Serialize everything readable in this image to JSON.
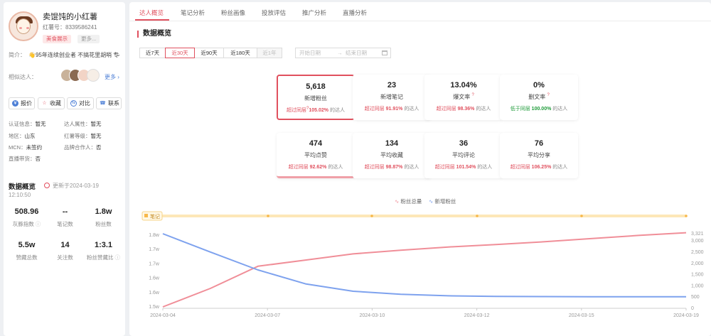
{
  "profile": {
    "nickname": "卖馄饨的小红薯",
    "red_id": "红薯号：8339586241",
    "tag_food": "美食展示",
    "tag_more": "更多...",
    "intro_label": "简介：",
    "intro_text": "👋95年连续创业者 不搞花里胡哨 专",
    "similar_label": "相似达人：",
    "similar_more": "更多",
    "buttons": {
      "quote": "报价",
      "favorite": "收藏",
      "compare": "对比",
      "contact": "联系"
    },
    "info": {
      "cert_label": "认证信息：",
      "cert_value": "暂无",
      "attr_label": "达人属性：",
      "attr_value": "暂无",
      "region_label": "地区：",
      "region_value": "山东",
      "level_label": "红薯等级：",
      "level_value": "暂无",
      "mcn_label": "MCN：",
      "mcn_value": "未签约",
      "brand_label": "品牌合作人：",
      "brand_value": "否",
      "live_label": "直播带货：",
      "live_value": "否"
    },
    "overview": {
      "title": "数据概览",
      "update_line1": "更新于2024-03-19",
      "update_line2": "12:10:50",
      "stats": [
        {
          "value": "508.96",
          "label": "灰豚指数"
        },
        {
          "value": "--",
          "label": "笔记数"
        },
        {
          "value": "1.8w",
          "label": "粉丝数"
        },
        {
          "value": "5.5w",
          "label": "赞藏总数"
        },
        {
          "value": "14",
          "label": "关注数"
        },
        {
          "value": "1:3.1",
          "label": "粉丝赞藏比"
        }
      ]
    }
  },
  "tabs": [
    "达人概览",
    "笔记分析",
    "粉丝画像",
    "投放评估",
    "推广分析",
    "直播分析"
  ],
  "main_title": "数据概览",
  "ranges": [
    "近7天",
    "近30天",
    "近90天",
    "近180天",
    "近1年"
  ],
  "date": {
    "start": "开始日期",
    "sep": "→",
    "end": "结束日期"
  },
  "cards": [
    {
      "value": "5,618",
      "label": "新增粉丝",
      "prefix": "超过同层",
      "pct": "105.02%",
      "suffix": "的达人",
      "tone": "red"
    },
    {
      "value": "23",
      "label": "新增笔记",
      "prefix": "超过同层",
      "pct": "91.91%",
      "suffix": "的达人",
      "tone": "red"
    },
    {
      "value": "13.04%",
      "label": "爆文率",
      "prefix": "超过同层",
      "pct": "98.36%",
      "suffix": "的达人",
      "tone": "red"
    },
    {
      "value": "0%",
      "label": "删文率",
      "prefix": "低于同层",
      "pct": "100.00%",
      "suffix": "的达人",
      "tone": "green"
    },
    {
      "value": "474",
      "label": "平均点赞",
      "prefix": "超过同层",
      "pct": "92.62%",
      "suffix": "的达人",
      "tone": "red"
    },
    {
      "value": "134",
      "label": "平均收藏",
      "prefix": "超过同层",
      "pct": "98.87%",
      "suffix": "的达人",
      "tone": "red"
    },
    {
      "value": "36",
      "label": "平均评论",
      "prefix": "超过同层",
      "pct": "101.54%",
      "suffix": "的达人",
      "tone": "red"
    },
    {
      "value": "76",
      "label": "平均分享",
      "prefix": "超过同层",
      "pct": "106.25%",
      "suffix": "的达人",
      "tone": "red"
    }
  ],
  "colors": {
    "accent": "#e0505e",
    "total_line": "#f08e98",
    "new_line": "#7ea2ee",
    "note_bar": "#f7b84b"
  },
  "chart_data": {
    "type": "line",
    "legend": [
      "粉丝总量",
      "新增粉丝"
    ],
    "note_label": "笔记",
    "x": [
      "2024-03-04",
      "2024-03-07",
      "2024-03-10",
      "2024-03-12",
      "2024-03-15",
      "2024-03-19"
    ],
    "y_left_ticks": [
      "1.5w",
      "1.6w",
      "1.6w",
      "1.7w",
      "1.7w",
      "1.8w"
    ],
    "y_right_ticks": [
      "0",
      "500",
      "1,000",
      "1,500",
      "2,000",
      "2,500",
      "3,000",
      "3,321"
    ],
    "series": [
      {
        "name": "粉丝总量",
        "axis": "left",
        "values": [
          15000,
          15750,
          16650,
          16900,
          17150,
          17300,
          17430,
          17530,
          17640,
          17770,
          17900,
          18010
        ]
      },
      {
        "name": "新增粉丝",
        "axis": "right",
        "values": [
          3321,
          2400,
          1500,
          800,
          430,
          280,
          200,
          170,
          160,
          150,
          150,
          150
        ]
      }
    ],
    "y_left_range": [
      15000,
      18200
    ],
    "y_right_range": [
      0,
      3321
    ]
  }
}
